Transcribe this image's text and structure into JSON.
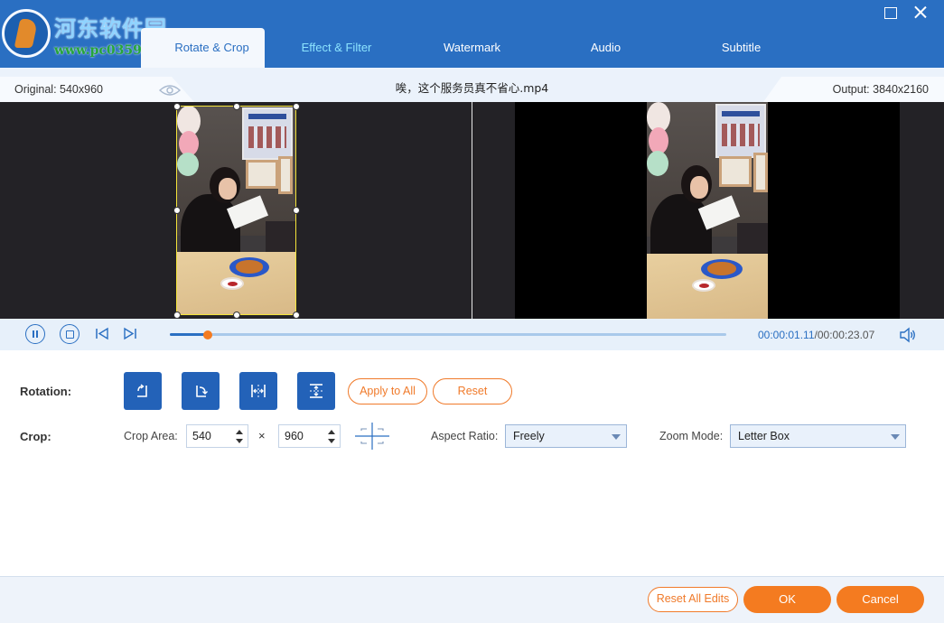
{
  "watermark": {
    "title": "河东软件园",
    "url": "www.pc0359.cn"
  },
  "tabs": [
    {
      "label": "Rotate & Crop",
      "active": true
    },
    {
      "label": "Effect & Filter",
      "active": false
    },
    {
      "label": "Watermark",
      "active": false
    },
    {
      "label": "Audio",
      "active": false
    },
    {
      "label": "Subtitle",
      "active": false
    }
  ],
  "info": {
    "original": "Original: 540x960",
    "file_name": "唉，这个服务员真不省心.mp4",
    "output": "Output: 3840x2160"
  },
  "playback": {
    "current_time": "00:00:01.11",
    "separator": "/",
    "total_time": "00:00:23.07",
    "progress_fraction": 0.068
  },
  "rotation": {
    "label": "Rotation:",
    "apply_all": "Apply to All",
    "reset": "Reset"
  },
  "crop": {
    "label": "Crop:",
    "area_label": "Crop Area:",
    "width": "540",
    "times": "×",
    "height": "960",
    "aspect_label": "Aspect Ratio:",
    "aspect_value": "Freely",
    "zoom_label": "Zoom Mode:",
    "zoom_value": "Letter Box"
  },
  "footer": {
    "reset_all": "Reset All Edits",
    "ok": "OK",
    "cancel": "Cancel"
  },
  "colors": {
    "brand_blue": "#2a6fc2",
    "accent_orange": "#f47b20"
  }
}
